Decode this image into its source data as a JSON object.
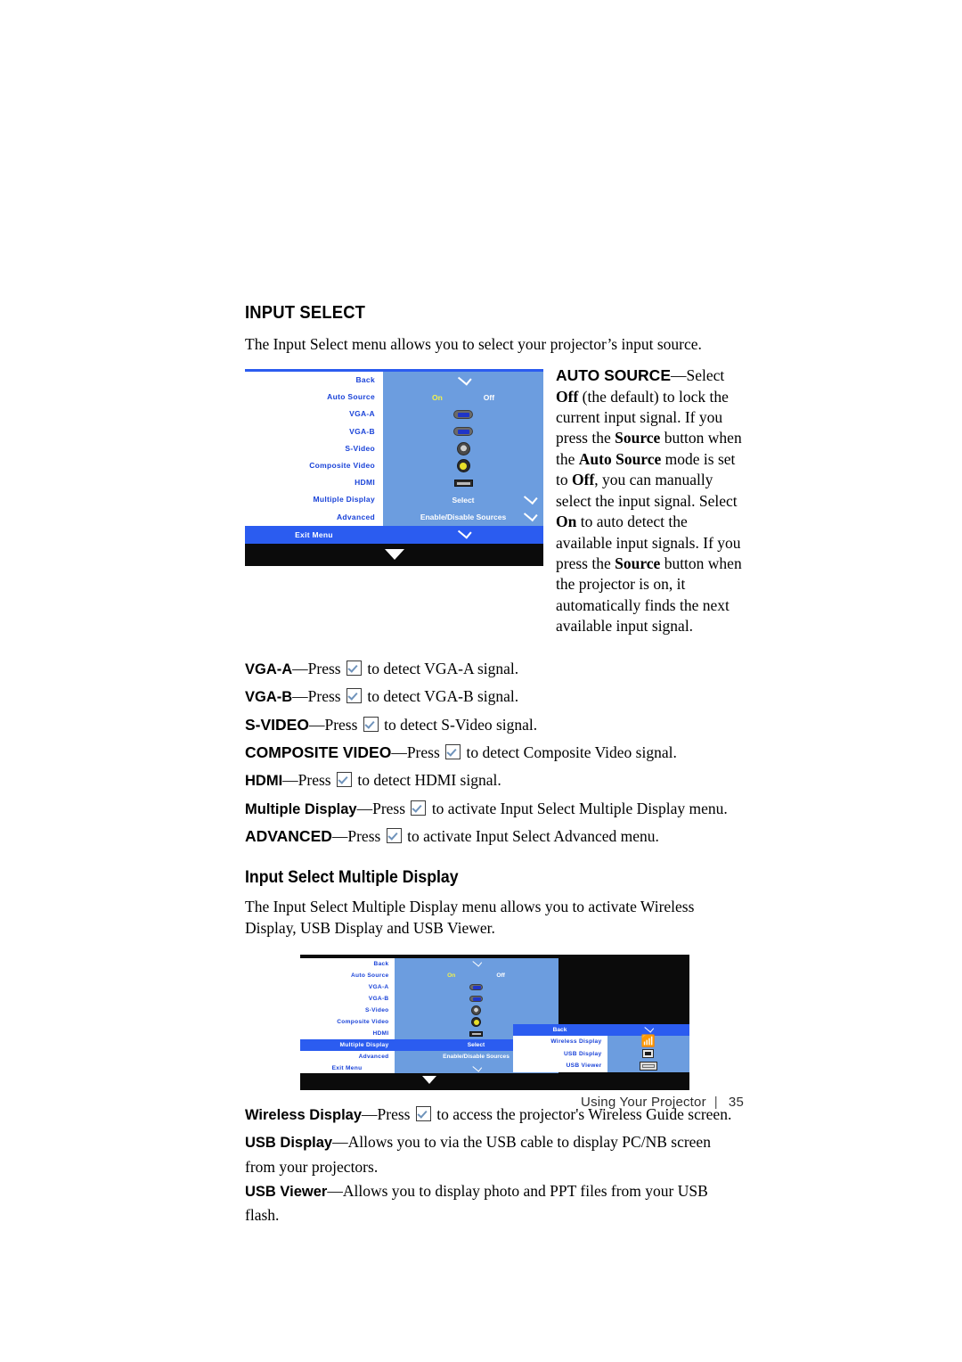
{
  "page": {
    "footer_label": "Using Your Projector",
    "footer_separator": "|",
    "footer_page_number": "35"
  },
  "section": {
    "title": "INPUT SELECT",
    "intro": "The Input Select menu allows you to select your projector’s input source."
  },
  "auto_source_description": {
    "term": "AUTO SOURCE",
    "dash": "—",
    "t1": "Select ",
    "b1": "Off",
    "t2": " (the default) to lock the current input signal. If you press the ",
    "b2": "Source",
    "t3": " button when the ",
    "b3": "Auto Source",
    "t4": " mode is set to ",
    "b4": "Off",
    "t5": ", you can manually select the input signal. Select ",
    "b5": "On",
    "t6": " to auto detect the available input signals. If you press the ",
    "b6": "Source",
    "t7": " button when the projector is on, it automatically finds the next available input signal."
  },
  "terms": [
    {
      "name": "vga-a",
      "term": "VGA-A",
      "smallcaps": false,
      "pre": "Press ",
      "post": " to detect VGA-A signal."
    },
    {
      "name": "vga-b",
      "term": "VGA-B",
      "smallcaps": false,
      "pre": "Press ",
      "post": " to detect VGA-B signal."
    },
    {
      "name": "s-video",
      "term": "S-VIDEO",
      "smallcaps": true,
      "pre": "Press ",
      "post": " to detect S-Video signal."
    },
    {
      "name": "composite-video",
      "term": "COMPOSITE VIDEO",
      "smallcaps": true,
      "pre": "Press ",
      "post": " to detect Composite Video signal."
    },
    {
      "name": "hdmi",
      "term": "HDMI",
      "smallcaps": false,
      "pre": "Press ",
      "post": " to detect HDMI signal."
    },
    {
      "name": "multiple-display",
      "term": "Multiple Display",
      "smallcaps": false,
      "pre": "Press ",
      "post": " to activate Input Select Multiple Display menu."
    },
    {
      "name": "advanced",
      "term": "ADVANCED",
      "smallcaps": true,
      "pre": "Press ",
      "post": " to activate Input Select Advanced menu."
    }
  ],
  "multiple_display_section": {
    "title": "Input Select Multiple Display",
    "intro": "The Input Select Multiple Display menu allows you to activate Wireless Display, USB Display and USB Viewer."
  },
  "bottom_terms": [
    {
      "name": "wireless-display",
      "term": "Wireless Display",
      "smallcaps": false,
      "pre": "Press ",
      "post": " to access the projector's Wireless Guide screen.",
      "has_icon": true
    },
    {
      "name": "usb-display",
      "term": "USB Display",
      "smallcaps": false,
      "pre": "",
      "post": "Allows you to via the USB cable to display PC/NB screen from your projectors.",
      "has_icon": false
    },
    {
      "name": "usb-viewer",
      "term": "USB Viewer",
      "smallcaps": false,
      "pre": "",
      "post": "Allows you to display photo and PPT files from your USB flash.",
      "has_icon": false
    }
  ],
  "osd_menu_1": {
    "rows": [
      {
        "label": "Back",
        "value": "",
        "icon": "check",
        "right_check": false,
        "selected": false
      },
      {
        "label": "Auto Source",
        "value_on": "On",
        "value_off": "Off",
        "icon": "onoff",
        "right_check": false,
        "selected": false
      },
      {
        "label": "VGA-A",
        "value": "",
        "icon": "vga",
        "right_check": false,
        "selected": false
      },
      {
        "label": "VGA-B",
        "value": "",
        "icon": "vga",
        "right_check": false,
        "selected": false
      },
      {
        "label": "S-Video",
        "value": "",
        "icon": "svideo",
        "right_check": false,
        "selected": false
      },
      {
        "label": "Composite Video",
        "value": "",
        "icon": "composite",
        "right_check": false,
        "selected": false
      },
      {
        "label": "HDMI",
        "value": "",
        "icon": "hdmi",
        "right_check": false,
        "selected": false
      },
      {
        "label": "Multiple Display",
        "value": "Select",
        "icon": "text",
        "right_check": true,
        "selected": false
      },
      {
        "label": "Advanced",
        "value": "Enable/Disable Sources",
        "icon": "text",
        "right_check": true,
        "selected": false
      }
    ],
    "exit": {
      "label": "Exit Menu",
      "icon": "check"
    }
  },
  "osd_menu_2": {
    "rows": [
      {
        "label": "Back",
        "value": "",
        "icon": "check",
        "right_check": false,
        "selected": false
      },
      {
        "label": "Auto Source",
        "value_on": "On",
        "value_off": "Off",
        "icon": "onoff",
        "right_check": false,
        "selected": false
      },
      {
        "label": "VGA-A",
        "value": "",
        "icon": "vga",
        "right_check": false,
        "selected": false
      },
      {
        "label": "VGA-B",
        "value": "",
        "icon": "vga",
        "right_check": false,
        "selected": false
      },
      {
        "label": "S-Video",
        "value": "",
        "icon": "svideo",
        "right_check": false,
        "selected": false
      },
      {
        "label": "Composite Video",
        "value": "",
        "icon": "composite",
        "right_check": false,
        "selected": false
      },
      {
        "label": "HDMI",
        "value": "",
        "icon": "hdmi",
        "right_check": false,
        "selected": false
      },
      {
        "label": "Multiple Display",
        "value": "Select",
        "icon": "text",
        "right_check": true,
        "selected": true
      },
      {
        "label": "Advanced",
        "value": "Enable/Disable Sources",
        "icon": "text",
        "right_check": true,
        "selected": false
      }
    ],
    "exit": {
      "label": "Exit Menu",
      "icon": "check"
    },
    "submenu": {
      "head": {
        "label": "Back",
        "icon": "check"
      },
      "rows": [
        {
          "label": "Wireless Display",
          "icon": "wifi"
        },
        {
          "label": "USB Display",
          "icon": "usb-display"
        },
        {
          "label": "USB Viewer",
          "icon": "usb-viewer"
        }
      ]
    }
  },
  "colors": {
    "osd_accent_blue": "#2b5cf0",
    "osd_panel_blue": "#6c9ddf",
    "osd_label_blue": "#1a43d8",
    "osd_yellow": "#f2f24a",
    "osd_black": "#0b0b0b"
  }
}
